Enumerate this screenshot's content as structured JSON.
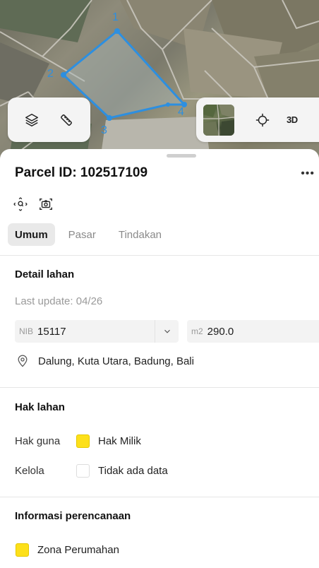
{
  "map": {
    "vertex_labels": [
      "1",
      "2",
      "3",
      "4"
    ],
    "parcel_color": "#2d8fe0",
    "tools": {
      "layers_icon": "layers-icon",
      "measure_icon": "ruler-icon"
    },
    "controls": {
      "basemap_icon": "satellite-thumbnail",
      "locate_icon": "crosshair-icon",
      "mode_3d_label": "3D"
    }
  },
  "sheet": {
    "title": "Parcel ID: 102517109",
    "more_label": "•••",
    "actions": [
      "zoom-to-parcel-icon",
      "screenshot-icon"
    ],
    "tabs": [
      {
        "label": "Umum",
        "active": true
      },
      {
        "label": "Pasar",
        "active": false
      },
      {
        "label": "Tindakan",
        "active": false
      }
    ]
  },
  "detail": {
    "heading": "Detail lahan",
    "last_update": "Last update: 04/26",
    "nib_prefix": "NIB",
    "nib_value": "15117",
    "area_prefix": "m2",
    "area_value": "290.0",
    "address": "Dalung, Kuta Utara, Badung, Bali"
  },
  "rights": {
    "heading": "Hak lahan",
    "rows": [
      {
        "label": "Hak guna",
        "value": "Hak Milik",
        "color": "#fde01a"
      },
      {
        "label": "Kelola",
        "value": "Tidak ada data",
        "color": "#ffffff"
      }
    ]
  },
  "planning": {
    "heading": "Informasi perencanaan",
    "zone": {
      "value": "Zona Perumahan",
      "color": "#fde01a"
    }
  }
}
